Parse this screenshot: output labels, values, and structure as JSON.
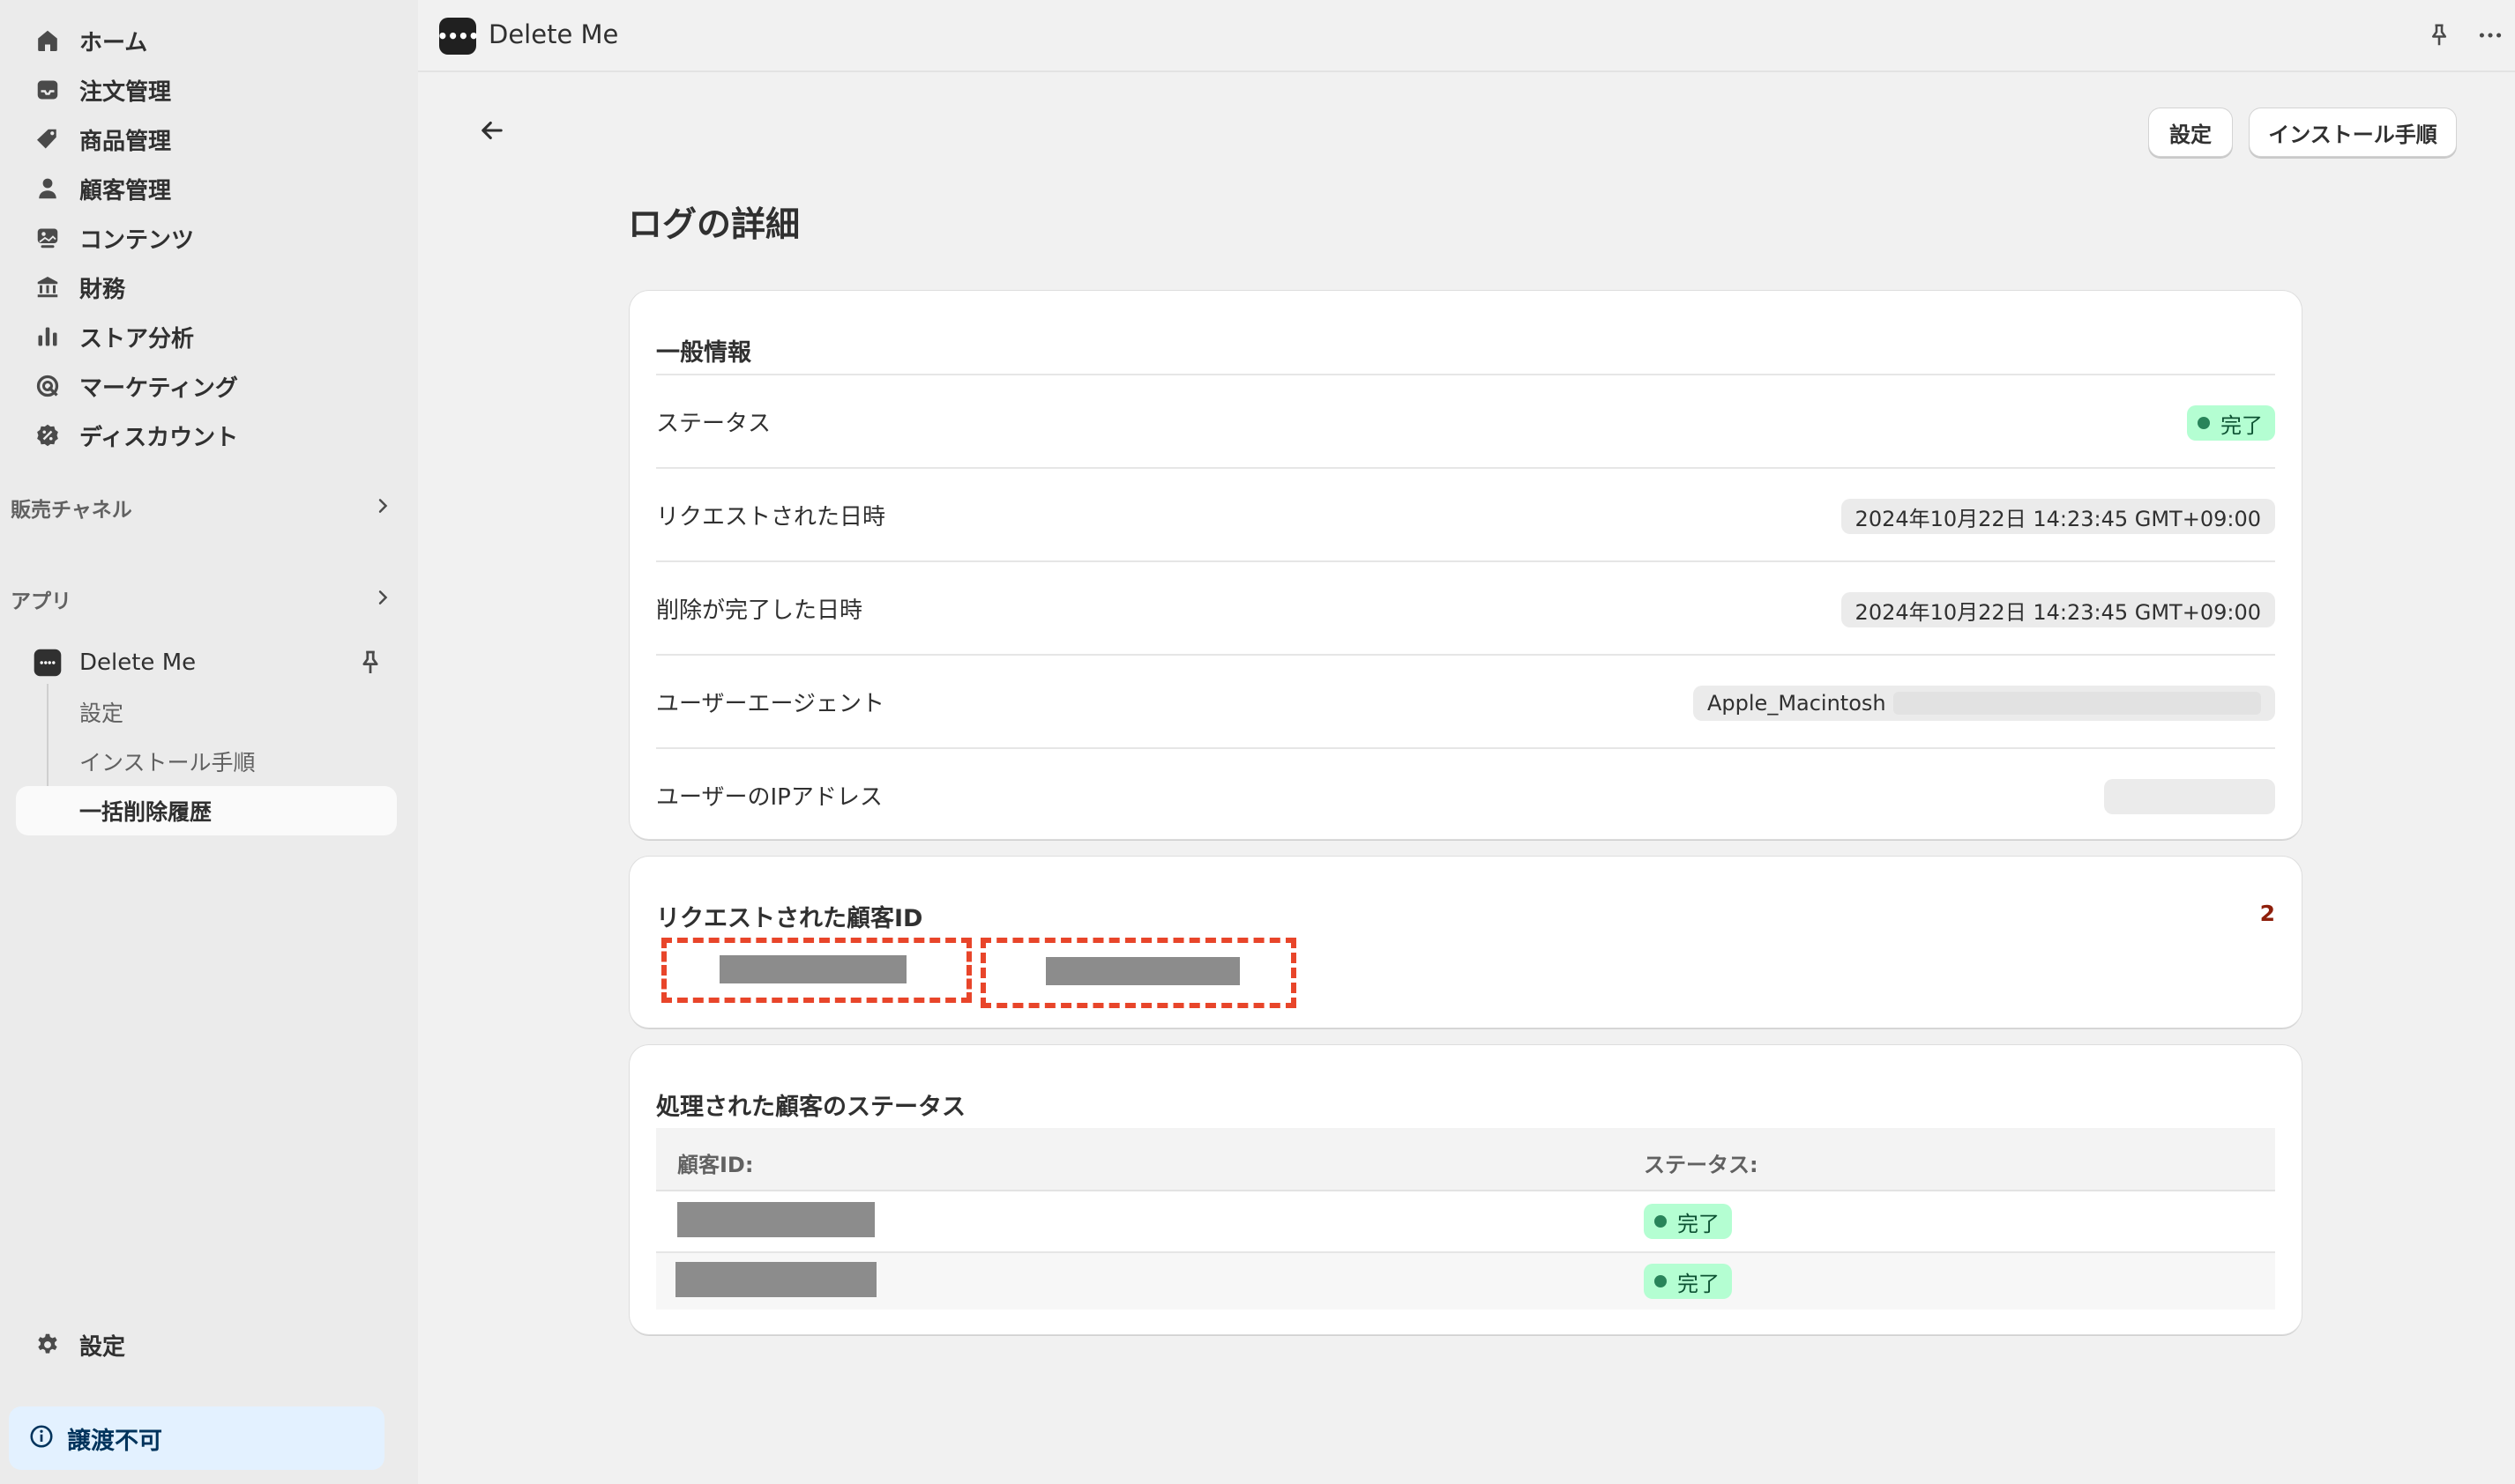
{
  "sidebar": {
    "nav": [
      {
        "label": "ホーム",
        "icon": "home-icon"
      },
      {
        "label": "注文管理",
        "icon": "inbox-icon"
      },
      {
        "label": "商品管理",
        "icon": "tag-icon"
      },
      {
        "label": "顧客管理",
        "icon": "person-icon"
      },
      {
        "label": "コンテンツ",
        "icon": "image-icon"
      },
      {
        "label": "財務",
        "icon": "bank-icon"
      },
      {
        "label": "ストア分析",
        "icon": "bar-chart-icon"
      },
      {
        "label": "マーケティング",
        "icon": "target-icon"
      },
      {
        "label": "ディスカウント",
        "icon": "discount-icon"
      }
    ],
    "sales_channels": "販売チャネル",
    "apps": "アプリ",
    "app": {
      "name": "Delete Me",
      "sub_items": [
        "設定",
        "インストール手順"
      ],
      "active_item": "一括削除履歴"
    },
    "settings": "設定",
    "notice": "譲渡不可"
  },
  "topbar": {
    "app_title": "Delete Me",
    "logo_text": "••••"
  },
  "main": {
    "buttons": {
      "settings": "設定",
      "install": "インストール手順"
    },
    "page_title": "ログの詳細",
    "general": {
      "title": "一般情報",
      "status_label": "ステータス",
      "status_value": "完了",
      "requested_label": "リクエストされた日時",
      "requested_value": "2024年10月22日 14:23:45 GMT+09:00",
      "completed_label": "削除が完了した日時",
      "completed_value": "2024年10月22日 14:23:45 GMT+09:00",
      "ua_label": "ユーザーエージェント",
      "ua_value": "Apple_Macintosh",
      "ip_label": "ユーザーのIPアドレス"
    },
    "requested_ids": {
      "title": "リクエストされた顧客ID",
      "count": "2"
    },
    "processed": {
      "title": "処理された顧客のステータス",
      "col_id": "顧客ID:",
      "col_status": "ステータス:",
      "rows": [
        {
          "status": "完了"
        },
        {
          "status": "完了"
        }
      ]
    }
  },
  "colors": {
    "success_badge_bg": "#b4fed2",
    "success_dot": "#29845a",
    "highlight_dash": "#e8452a",
    "count_color": "#8e1f0b"
  }
}
